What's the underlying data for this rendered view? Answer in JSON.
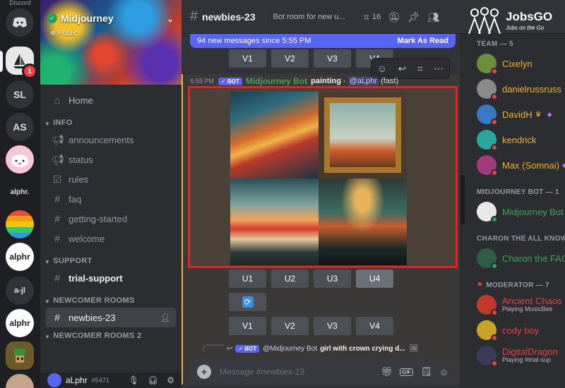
{
  "rail": {
    "brand": "Discord",
    "servers": [
      {
        "label": "",
        "icon": "discord-logo-icon"
      },
      {
        "label": "",
        "icon": "sailboat-icon",
        "badge": "1"
      },
      {
        "label": "SL"
      },
      {
        "label": "AS"
      },
      {
        "label": "",
        "icon": "pink-avatar"
      },
      {
        "label": "alphr.",
        "icon": "alphr-wordmark"
      },
      {
        "label": "",
        "icon": "rainbow-avatar"
      },
      {
        "label": "alphr",
        "icon": "alphr-circle"
      },
      {
        "label": "a-jl"
      },
      {
        "label": "alphr",
        "icon": "alphr-circle"
      },
      {
        "label": "",
        "icon": "pixel-avatar"
      },
      {
        "label": "",
        "icon": "face-avatar"
      }
    ]
  },
  "server": {
    "name": "Midjourney",
    "visibility": "Public"
  },
  "sidebar": {
    "home": "Home",
    "categories": [
      {
        "name": "INFO",
        "channels": [
          "announcements",
          "status",
          "rules",
          "faq",
          "getting-started",
          "welcome"
        ]
      },
      {
        "name": "SUPPORT",
        "channels": [
          "trial-support"
        ]
      },
      {
        "name": "NEWCOMER ROOMS",
        "channels": [
          "newbies-23"
        ]
      },
      {
        "name": "NEWCOMER ROOMS 2"
      }
    ]
  },
  "user": {
    "name": "aLphr",
    "tag": "#5471"
  },
  "header": {
    "channel": "newbies-23",
    "topic": "Bot room for new u...",
    "thread_count": "16"
  },
  "watermark": {
    "brand": "JobsGO",
    "tagline": "Jobs on the Go"
  },
  "chat": {
    "new_messages": "94 new messages since 5:55 PM",
    "mark_as_read": "Mark As Read",
    "variation_buttons": [
      "V1",
      "V2",
      "V3",
      "V4"
    ],
    "upscale_buttons": [
      "U1",
      "U2",
      "U3",
      "U4"
    ],
    "message": {
      "time": "5:55 PM",
      "bot_tag": "BOT",
      "author": "Midjourney Bot",
      "prompt": "painting",
      "separator": " - ",
      "mention": "@aLphr",
      "speed": "(fast)"
    },
    "reply": {
      "bot_tag": "BOT",
      "mention": "@Midjourney Bot",
      "text": "girl with crown crying d..."
    },
    "composer_placeholder": "Message #newbies-23"
  },
  "members": {
    "groups": [
      {
        "title": "TEAM — 5",
        "items": [
          {
            "name": "Cixelyn",
            "color": "#f0b232",
            "avatar": "#6a8f3a"
          },
          {
            "name": "danielrussruss",
            "color": "#f0b232",
            "avatar": "#8a8a8a"
          },
          {
            "name": "DavidH",
            "color": "#f0b232",
            "avatar": "#3b78c4"
          },
          {
            "name": "kendrick",
            "color": "#f0b232",
            "avatar": "#2aa79b"
          },
          {
            "name": "Max (Somnai)",
            "color": "#f0b232",
            "avatar": "#a03a7a"
          }
        ]
      },
      {
        "title": "MIDJOURNEY BOT — 1",
        "items": [
          {
            "name": "Midjourney Bot",
            "color": "#3ba55c",
            "avatar": "#ffffff"
          }
        ]
      },
      {
        "title": "CHARON THE ALL KNOWING",
        "items": [
          {
            "name": "Charon the FAQ",
            "color": "#3ba55c",
            "avatar": "#2f5d4a"
          }
        ]
      },
      {
        "title": "MODERATOR — 7",
        "items": [
          {
            "name": "Ancient Chaos",
            "color": "#e04343",
            "avatar": "#c0392b",
            "activity": "Playing MusicBee"
          },
          {
            "name": "cody boy",
            "color": "#e04343",
            "avatar": "#c9a227"
          },
          {
            "name": "DigitalDragon",
            "color": "#e04343",
            "avatar": "#3a3a5a",
            "activity": "Playing #trial-sup"
          }
        ]
      }
    ]
  }
}
